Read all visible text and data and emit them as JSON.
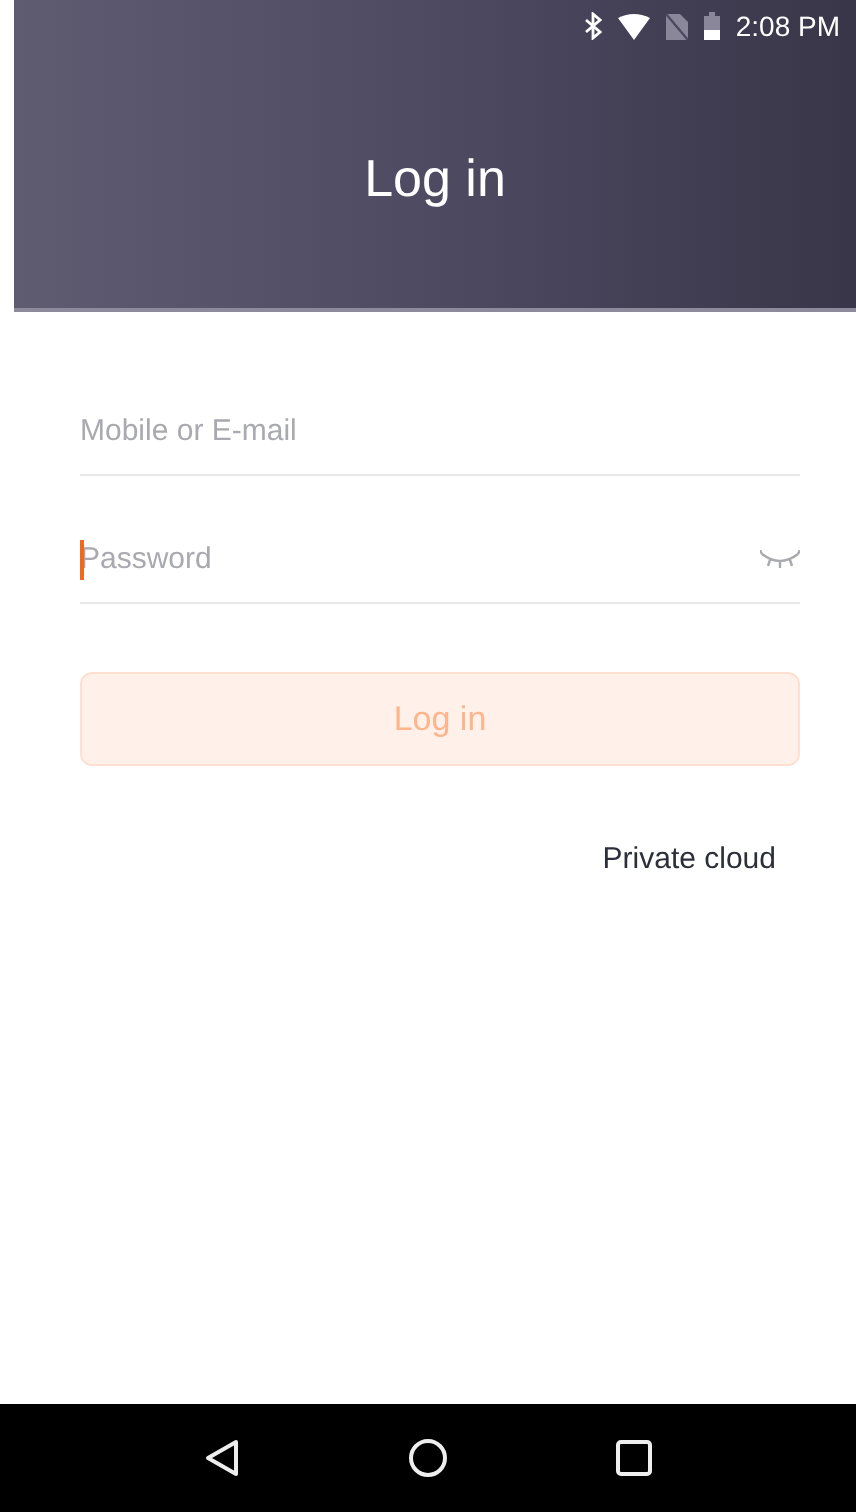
{
  "status_bar": {
    "time": "2:08 PM"
  },
  "header": {
    "title": "Log in"
  },
  "fields": [
    {
      "placeholder": "Mobile or E-mail",
      "focused": false,
      "kind": "text"
    },
    {
      "placeholder": "Password",
      "focused": true,
      "kind": "password"
    }
  ],
  "login_button": {
    "label": "Log in",
    "disabled": true
  },
  "private_cloud_link": "Private cloud"
}
